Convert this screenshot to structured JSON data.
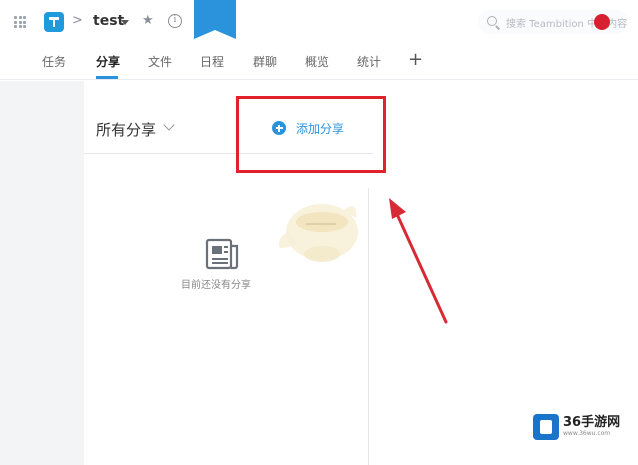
{
  "header": {
    "project_name": "test",
    "crumb_separator": ">",
    "search_placeholder": "搜索 Teambition 中的内容"
  },
  "tabs": [
    {
      "label": "任务",
      "active": false
    },
    {
      "label": "分享",
      "active": true
    },
    {
      "label": "文件",
      "active": false
    },
    {
      "label": "日程",
      "active": false
    },
    {
      "label": "群聊",
      "active": false
    },
    {
      "label": "概览",
      "active": false
    },
    {
      "label": "统计",
      "active": false
    }
  ],
  "tab_add_label": "+",
  "main": {
    "filter_label": "所有分享",
    "add_share_label": "添加分享",
    "empty_text": "目前还没有分享"
  },
  "watermark": {
    "title": "36手游网",
    "url": "www.36wu.com"
  },
  "colors": {
    "accent": "#2b93db",
    "highlight": "#e1212b"
  }
}
